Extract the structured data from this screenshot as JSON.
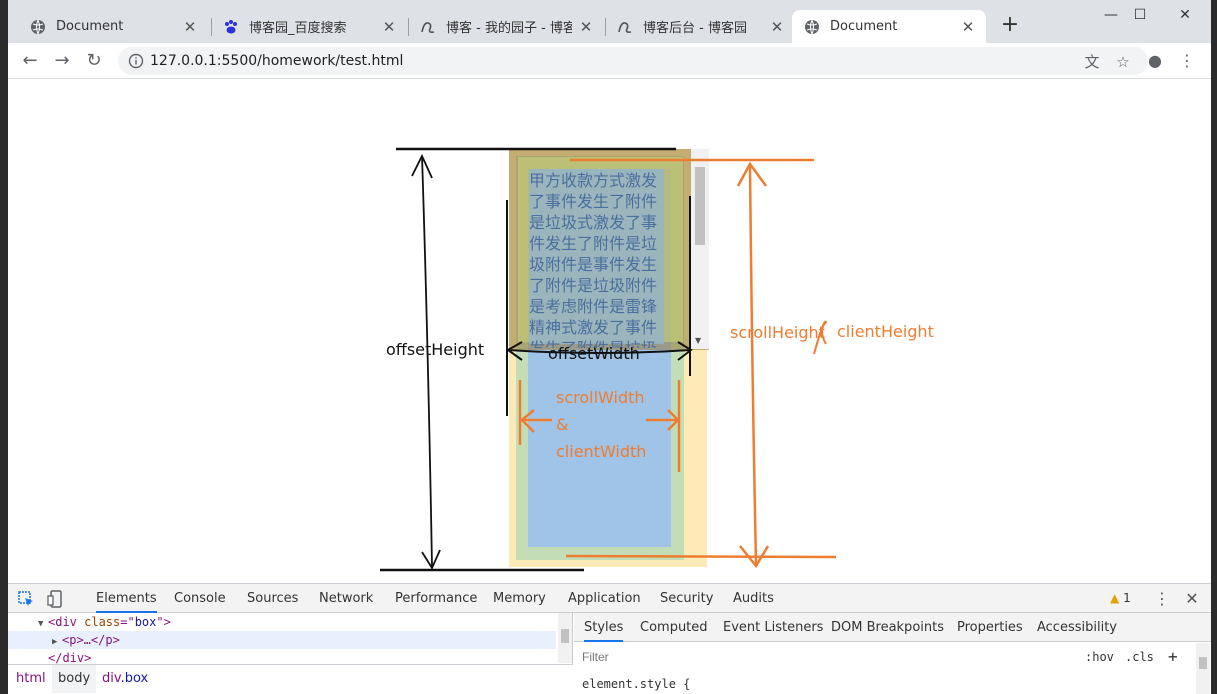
{
  "tabs": [
    {
      "title": "Document",
      "icon": "globe-icon",
      "close": "✕"
    },
    {
      "title": "博客园_百度搜索",
      "icon": "baidu-paw-icon",
      "close": "✕"
    },
    {
      "title": "博客 - 我的园子 - 博客园",
      "icon": "cnblogs-icon",
      "close": "✕"
    },
    {
      "title": "博客后台 - 博客园",
      "icon": "cnblogs-icon",
      "close": "✕"
    },
    {
      "title": "Document",
      "icon": "globe-icon",
      "close": "✕",
      "active": true
    }
  ],
  "new_tab": "+",
  "window_controls": {
    "minimize": "—",
    "maximize": "☐",
    "close": "✕"
  },
  "toolbar": {
    "back": "←",
    "forward": "→",
    "reload": "↻",
    "url": "127.0.0.1:5500/homework/test.html",
    "translate": "文",
    "bookmark": "☆",
    "account": "●",
    "menu": "⋮"
  },
  "page": {
    "box_text": "甲方收款方式激发了事件发生了附件是垃圾式激发了事件发生了附件是垃圾附件是事件发生了附件是垃圾附件是考虑附件是雷锋精神式激发了事件发生了附件是垃圾",
    "annotations": {
      "offset_height": "offsetHeight",
      "offset_width": "offsetWidth",
      "scroll_width": "scrollWidth",
      "ampersand": "&",
      "client_width": "clientWidth",
      "scroll_height": "scrollHeight",
      "client_height": "clientHeight"
    }
  },
  "devtools": {
    "tabs": [
      "Elements",
      "Console",
      "Sources",
      "Network",
      "Performance",
      "Memory",
      "Application",
      "Security",
      "Audits"
    ],
    "active_tab": "Elements",
    "warnings": "1",
    "dom": [
      {
        "tag_open": "<div ",
        "attr": "class",
        "eq": "=\"",
        "value": "box",
        "end": "\">"
      },
      {
        "text": "<p>…</p>"
      },
      {
        "text": "</div>"
      }
    ],
    "breadcrumb": [
      "html",
      "body",
      "div",
      ".box"
    ],
    "styles_tabs": [
      "Styles",
      "Computed",
      "Event Listeners",
      "DOM Breakpoints",
      "Properties",
      "Accessibility"
    ],
    "active_styles_tab": "Styles",
    "filter_placeholder": "Filter",
    "hov": ":hov",
    "cls": ".cls",
    "plus": "+",
    "element_style": "element.style {"
  },
  "colors": {
    "annotation_orange": "#ed7d31",
    "annotation_black": "#111111",
    "box_text": "#4a6f9e",
    "border_fill": "#fcebb6",
    "margin_fill": "#c3deb7",
    "content_fill": "#9fc4e7"
  }
}
